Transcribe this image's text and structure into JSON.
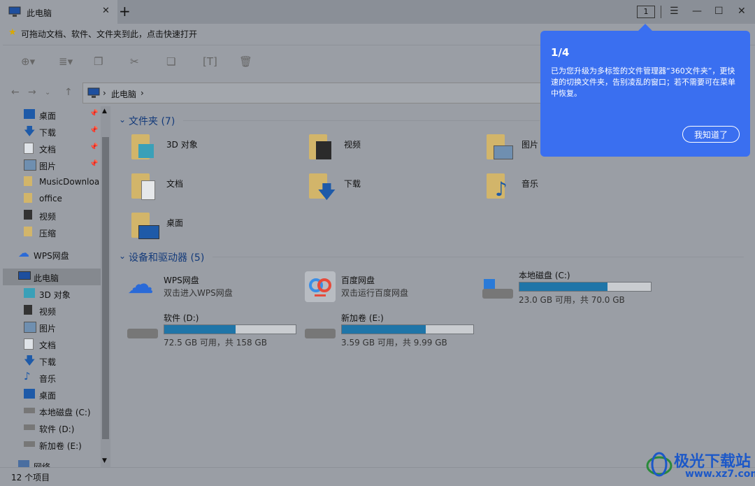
{
  "tab": {
    "title": "此电脑",
    "close": "✕",
    "new": "+"
  },
  "window": {
    "tab_count": "1",
    "menu": "☰",
    "minimize": "—",
    "maximize": "☐",
    "close": "✕"
  },
  "quickbar": {
    "hint": "可拖动文档、软件、文件夹到此，点击快速打开"
  },
  "address": {
    "crumb": "此电脑"
  },
  "sidebar": {
    "items": [
      {
        "label": "桌面",
        "pin": "📌"
      },
      {
        "label": "下载",
        "pin": "📌"
      },
      {
        "label": "文档",
        "pin": "📌"
      },
      {
        "label": "图片",
        "pin": "📌"
      },
      {
        "label": "MusicDownloa",
        "pin": ""
      },
      {
        "label": "office",
        "pin": ""
      },
      {
        "label": "视频",
        "pin": ""
      },
      {
        "label": "压缩",
        "pin": ""
      },
      {
        "label": "WPS网盘",
        "pin": ""
      },
      {
        "label": "此电脑",
        "pin": ""
      },
      {
        "label": "3D 对象",
        "pin": ""
      },
      {
        "label": "视频",
        "pin": ""
      },
      {
        "label": "图片",
        "pin": ""
      },
      {
        "label": "文档",
        "pin": ""
      },
      {
        "label": "下载",
        "pin": ""
      },
      {
        "label": "音乐",
        "pin": ""
      },
      {
        "label": "桌面",
        "pin": ""
      },
      {
        "label": "本地磁盘 (C:)",
        "pin": ""
      },
      {
        "label": "软件 (D:)",
        "pin": ""
      },
      {
        "label": "新加卷 (E:)",
        "pin": ""
      },
      {
        "label": "网络",
        "pin": ""
      }
    ]
  },
  "folders_section": {
    "title": "文件夹 (7)"
  },
  "folders": [
    "3D 对象",
    "视频",
    "图片",
    "文档",
    "下载",
    "音乐",
    "桌面"
  ],
  "devices_section": {
    "title": "设备和驱动器 (5)"
  },
  "devices": {
    "wps": {
      "name": "WPS网盘",
      "sub": "双击进入WPS网盘"
    },
    "baidu": {
      "name": "百度网盘",
      "sub": "双击运行百度网盘"
    },
    "c": {
      "name": "本地磁盘 (C:)",
      "sub": "23.0 GB 可用，共 70.0 GB",
      "used_fraction": 0.67
    },
    "d": {
      "name": "软件 (D:)",
      "sub": "72.5 GB 可用，共 158 GB",
      "used_fraction": 0.54
    },
    "e": {
      "name": "新加卷 (E:)",
      "sub": "3.59 GB 可用，共 9.99 GB",
      "used_fraction": 0.64
    }
  },
  "status": {
    "count": "12 个项目"
  },
  "popup": {
    "step": "1/4",
    "body": "已为您升级为多标签的文件管理器“360文件夹”，更快速的切换文件夹，告别凌乱的窗口；若不需要可在菜单中恢复。",
    "button": "我知道了"
  },
  "watermark": {
    "line1": "极光下载站",
    "line2": "www.xz7.com"
  },
  "colors": {
    "accent": "#3a6ff0",
    "drive_fill": "#1f75a8"
  }
}
